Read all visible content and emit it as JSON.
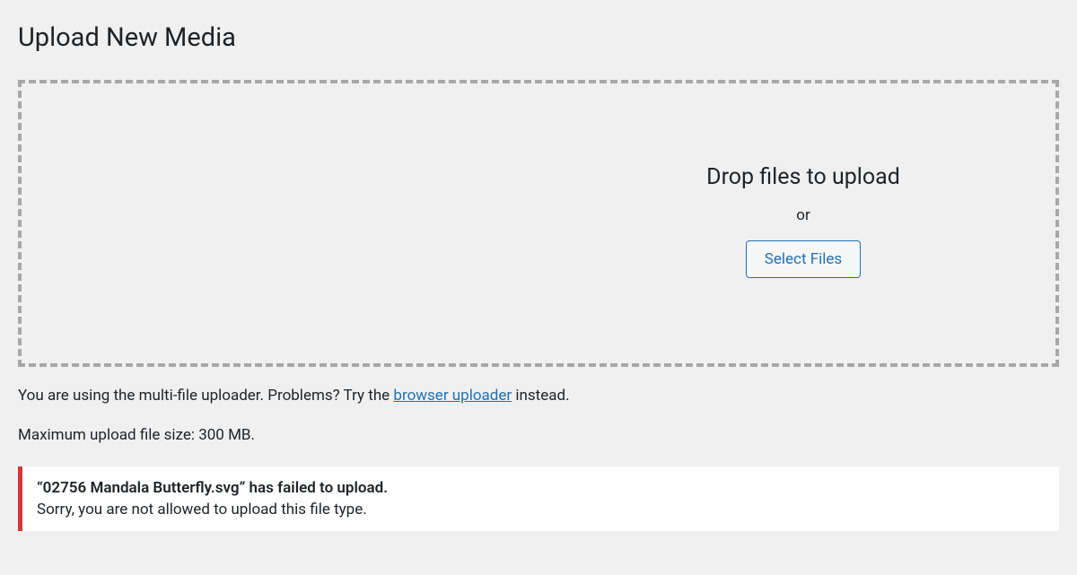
{
  "page": {
    "title": "Upload New Media"
  },
  "dropZone": {
    "dropText": "Drop files to upload",
    "orText": "or",
    "selectButton": "Select Files"
  },
  "info": {
    "prefix": "You are using the multi-file uploader. Problems? Try the ",
    "linkText": "browser uploader",
    "suffix": " instead."
  },
  "maxSize": {
    "text": "Maximum upload file size: 300 MB."
  },
  "error": {
    "filename": "“02756 Mandala Butterfly.svg” has failed to upload.",
    "message": "Sorry, you are not allowed to upload this file type."
  }
}
